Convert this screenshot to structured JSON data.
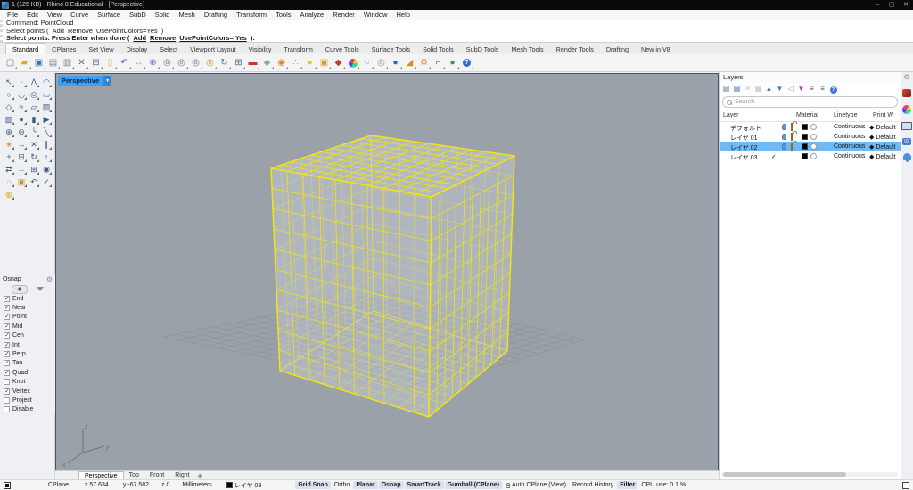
{
  "window": {
    "title": "1 (125 KB) - Rhino 8 Educational - [Perspective]",
    "controls": [
      {
        "name": "minimize",
        "glyph": "–"
      },
      {
        "name": "maximize",
        "glyph": "▢"
      },
      {
        "name": "close",
        "glyph": "✕"
      }
    ]
  },
  "menu": [
    "File",
    "Edit",
    "View",
    "Curve",
    "Surface",
    "SubD",
    "Solid",
    "Mesh",
    "Drafting",
    "Transform",
    "Tools",
    "Analyze",
    "Render",
    "Window",
    "Help"
  ],
  "command": {
    "lines": [
      {
        "prefix": "Command: PointCloud",
        "options": [],
        "suffix": "",
        "bold": false,
        "underline": false
      },
      {
        "prefix": "Select points ( ",
        "options": [
          "Add",
          "Remove",
          "UsePointColors=Yes"
        ],
        "suffix": " )",
        "bold": false,
        "underline": false
      },
      {
        "prefix": "Select points. Press Enter when done ( ",
        "options": [
          "Add",
          "Remove",
          "UsePointColors= Yes"
        ],
        "suffix": " ):",
        "bold": true,
        "underline": true
      }
    ]
  },
  "toolbar_tabs": {
    "active": "Standard",
    "tabs": [
      "Standard",
      "CPlanes",
      "Set View",
      "Display",
      "Select",
      "Viewport Layout",
      "Visibility",
      "Transform",
      "Curve Tools",
      "Surface Tools",
      "Solid Tools",
      "SubD Tools",
      "Mesh Tools",
      "Render Tools",
      "Drafting",
      "New in V8"
    ]
  },
  "standard_toolbar": [
    {
      "name": "new-file",
      "glyph": "▢",
      "color": "#6b7c92"
    },
    {
      "name": "open-file",
      "glyph": "▰",
      "color": "#e0a33a"
    },
    {
      "name": "save",
      "glyph": "▣",
      "color": "#3f6fb5"
    },
    {
      "name": "print",
      "glyph": "▤",
      "color": "#7c8692"
    },
    {
      "name": "export",
      "glyph": "▥",
      "color": "#7c8692"
    },
    {
      "name": "cut",
      "glyph": "✕",
      "color": "#5a6b7c"
    },
    {
      "name": "copy",
      "glyph": "⊟",
      "color": "#5a6b7c"
    },
    {
      "name": "paste",
      "glyph": "▯",
      "color": "#e0a33a"
    },
    {
      "name": "undo",
      "glyph": "↶",
      "color": "#3f6fb5"
    },
    {
      "name": "pan-view",
      "glyph": "↔",
      "color": "#d9a05a"
    },
    {
      "name": "move",
      "glyph": "⊕",
      "color": "#8a5ad4"
    },
    {
      "name": "zoom-dynamic",
      "glyph": "◎",
      "color": "#5a7c9c"
    },
    {
      "name": "zoom-window",
      "glyph": "◎",
      "color": "#5a7c9c"
    },
    {
      "name": "zoom-extents",
      "glyph": "◎",
      "color": "#5a7c9c"
    },
    {
      "name": "zoom-selected",
      "glyph": "◎",
      "color": "#d98a2b"
    },
    {
      "name": "rotate-view",
      "glyph": "↻",
      "color": "#3f6fb5"
    },
    {
      "name": "viewport-layout",
      "glyph": "⊞",
      "color": "#5a6b7c"
    },
    {
      "name": "display-mode-rendered",
      "glyph": "▬",
      "color": "#c23b2e"
    },
    {
      "name": "display-mode-shaded",
      "glyph": "◆",
      "color": "#98a2ae"
    },
    {
      "name": "sun-study",
      "glyph": "◉",
      "color": "#d98a2b"
    },
    {
      "name": "object-snap-points",
      "glyph": "∴",
      "color": "#d98a2b"
    },
    {
      "name": "hide-objects",
      "glyph": "●",
      "color": "#e8c52a"
    },
    {
      "name": "lock-objects",
      "glyph": "▣",
      "color": "#c9a227"
    },
    {
      "name": "edit-layers",
      "glyph": "◆",
      "color": "#c23b2e"
    },
    {
      "name": "display-properties",
      "glyph": "wheel",
      "color": ""
    },
    {
      "name": "object-properties",
      "glyph": "○",
      "color": "#8a929c"
    },
    {
      "name": "what-is",
      "glyph": "◎",
      "color": "#8a929c"
    },
    {
      "name": "render",
      "glyph": "●",
      "color": "#2b5fd4"
    },
    {
      "name": "render-settings",
      "glyph": "◢",
      "color": "#d98a2b"
    },
    {
      "name": "options",
      "glyph": "⚙",
      "color": "#d98a2b"
    },
    {
      "name": "dimension",
      "glyph": "⌐",
      "color": "#5a6b7c"
    },
    {
      "name": "render-earth",
      "glyph": "●",
      "color": "#2ba03a"
    },
    {
      "name": "help",
      "glyph": "?",
      "color": "#ffffff"
    }
  ],
  "left_toolbar": [
    {
      "name": "select",
      "glyph": "↖",
      "color": "#3a5a85"
    },
    {
      "name": "point",
      "glyph": "∙",
      "color": "#3a5a85"
    },
    {
      "name": "polyline",
      "glyph": "Λ",
      "color": "#3a5a85"
    },
    {
      "name": "curve",
      "glyph": "◠",
      "color": "#3a5a85"
    },
    {
      "name": "circle",
      "glyph": "○",
      "color": "#3a5a85"
    },
    {
      "name": "arc",
      "glyph": "◡",
      "color": "#3a5a85"
    },
    {
      "name": "ellipse",
      "glyph": "◎",
      "color": "#3a5a85"
    },
    {
      "name": "rectangle",
      "glyph": "▭",
      "color": "#3a5a85"
    },
    {
      "name": "polygon",
      "glyph": "◇",
      "color": "#3a5a85"
    },
    {
      "name": "sketch",
      "glyph": "≈",
      "color": "#3a5a85"
    },
    {
      "name": "surface",
      "glyph": "▱",
      "color": "#3a5a85"
    },
    {
      "name": "patch",
      "glyph": "▨",
      "color": "#3a5a85"
    },
    {
      "name": "box",
      "glyph": "▧",
      "color": "#3a5a85"
    },
    {
      "name": "sphere",
      "glyph": "●",
      "color": "#3a5a85"
    },
    {
      "name": "extrude",
      "glyph": "▮",
      "color": "#3a5a85"
    },
    {
      "name": "revolve",
      "glyph": "▶",
      "color": "#3a5a85"
    },
    {
      "name": "boolean-union",
      "glyph": "⊕",
      "color": "#3a5a85"
    },
    {
      "name": "boolean-difference",
      "glyph": "⊖",
      "color": "#3a5a85"
    },
    {
      "name": "fillet",
      "glyph": "╰",
      "color": "#3a5a85"
    },
    {
      "name": "chamfer",
      "glyph": "╲",
      "color": "#3a5a85"
    },
    {
      "name": "explode",
      "glyph": "∗",
      "color": "#d98a2b"
    },
    {
      "name": "extend",
      "glyph": "→",
      "color": "#3a5a85"
    },
    {
      "name": "trim",
      "glyph": "✕",
      "color": "#3a5a85"
    },
    {
      "name": "split",
      "glyph": "∥",
      "color": "#3a5a85"
    },
    {
      "name": "move",
      "glyph": "+",
      "color": "#3a5a85"
    },
    {
      "name": "copy-object",
      "glyph": "⊟",
      "color": "#3a5a85"
    },
    {
      "name": "rotate",
      "glyph": "↻",
      "color": "#3a5a85"
    },
    {
      "name": "scale",
      "glyph": "↕",
      "color": "#3a5a85"
    },
    {
      "name": "mirror",
      "glyph": "⇄",
      "color": "#3a5a85"
    },
    {
      "name": "array",
      "glyph": "∴",
      "color": "#3a5a85"
    },
    {
      "name": "join",
      "glyph": "⊞",
      "color": "#3a5a85"
    },
    {
      "name": "group",
      "glyph": "◉",
      "color": "#3a5a85"
    },
    {
      "name": "hide",
      "glyph": "◌",
      "color": "#3a5a85"
    },
    {
      "name": "lock",
      "glyph": "▣",
      "color": "#b8962a"
    },
    {
      "name": "undo-tool",
      "glyph": "↶",
      "color": "#3a5a85"
    },
    {
      "name": "record-history",
      "glyph": "✓",
      "color": "#3a5a85"
    },
    {
      "name": "lamp",
      "glyph": "◍",
      "color": "#d0a818"
    }
  ],
  "osnap": {
    "title": "Osnap",
    "items": [
      {
        "label": "End",
        "checked": true
      },
      {
        "label": "Near",
        "checked": true
      },
      {
        "label": "Point",
        "checked": true
      },
      {
        "label": "Mid",
        "checked": true
      },
      {
        "label": "Cen",
        "checked": true
      },
      {
        "label": "Int",
        "checked": true
      },
      {
        "label": "Perp",
        "checked": true
      },
      {
        "label": "Tan",
        "checked": true
      },
      {
        "label": "Quad",
        "checked": true
      },
      {
        "label": "Knot",
        "checked": false
      },
      {
        "label": "Vertex",
        "checked": true
      },
      {
        "label": "Project",
        "checked": false
      },
      {
        "label": "Disable",
        "checked": false
      }
    ]
  },
  "viewport": {
    "label": "Perspective",
    "axis_labels": {
      "x": "x",
      "y": "y",
      "z": "z"
    }
  },
  "viewport_tabs": {
    "active": "Perspective",
    "tabs": [
      "Perspective",
      "Top",
      "Front",
      "Right"
    ],
    "new_tab_glyph": "◈"
  },
  "layers": {
    "title": "Layers",
    "search_placeholder": "Search",
    "toolbar": [
      {
        "name": "new-layer",
        "glyph": "▤",
        "color": "#6b7c92"
      },
      {
        "name": "new-sublayer",
        "glyph": "▤",
        "color": "#3f6fb5"
      },
      {
        "name": "delete-layer",
        "glyph": "✕",
        "color": "#bdc2c8"
      },
      {
        "name": "duplicate-layer",
        "glyph": "▦",
        "color": "#bdc2c8"
      },
      {
        "name": "move-up",
        "glyph": "▲",
        "color": "#3f78d6"
      },
      {
        "name": "move-down",
        "glyph": "▼",
        "color": "#3f78d6"
      },
      {
        "name": "collapse",
        "glyph": "◁",
        "color": "#9aa0a6"
      },
      {
        "name": "filter",
        "glyph": "▼",
        "color": "#b13fc9"
      },
      {
        "name": "list-view",
        "glyph": "≡",
        "color": "#555555"
      },
      {
        "name": "panel-menu",
        "glyph": "≡",
        "color": "#555555"
      },
      {
        "name": "help",
        "glyph": "?",
        "color": "#ffffff"
      }
    ],
    "columns": [
      "Layer",
      "Material",
      "Linetype",
      "Print W"
    ],
    "rows": [
      {
        "name": "デフォルト",
        "current": false,
        "visible": true,
        "locked": false,
        "color": "#000000",
        "linetype": "Continuous",
        "print_width": "Default",
        "selected": false,
        "state_icons": true
      },
      {
        "name": "レイヤ 01",
        "current": false,
        "visible": true,
        "locked": false,
        "color": "#000000",
        "linetype": "Continuous",
        "print_width": "Default",
        "selected": false,
        "state_icons": true
      },
      {
        "name": "レイヤ 02",
        "current": false,
        "visible": true,
        "locked": false,
        "color": "#000000",
        "linetype": "Continuous",
        "print_width": "Default",
        "selected": true,
        "state_icons": true
      },
      {
        "name": "レイヤ 03",
        "current": true,
        "visible": true,
        "locked": false,
        "color": "#000000",
        "linetype": "Continuous",
        "print_width": "Default",
        "selected": false,
        "state_icons": false
      }
    ]
  },
  "right_strip": [
    {
      "name": "panel-gear",
      "type": "gear"
    },
    {
      "name": "tab-materials",
      "type": "materials"
    },
    {
      "name": "tab-display",
      "type": "wheel"
    },
    {
      "name": "tab-rendering",
      "type": "monitor"
    },
    {
      "name": "tab-layer-states",
      "type": "layerstate",
      "label": "02"
    },
    {
      "name": "tab-notifications",
      "type": "bell"
    }
  ],
  "status_bar": {
    "fields": [
      {
        "name": "cplane",
        "text": "CPlane",
        "ml": 42
      },
      {
        "name": "coord-x",
        "text": "x 57.634",
        "ml": 18
      },
      {
        "name": "coord-y",
        "text": "y -67.582",
        "ml": 16
      },
      {
        "name": "coord-z",
        "text": "z 0",
        "ml": 14
      },
      {
        "name": "units",
        "text": "Millimeters",
        "ml": 14
      }
    ],
    "layer_chip": {
      "color": "#000000",
      "label": "レイヤ 03"
    },
    "toggles": [
      {
        "label": "Grid Snap",
        "active": true,
        "lock": false
      },
      {
        "label": "Ortho",
        "active": false,
        "lock": false
      },
      {
        "label": "Planar",
        "active": true,
        "lock": false
      },
      {
        "label": "Osnap",
        "active": true,
        "lock": false
      },
      {
        "label": "SmartTrack",
        "active": true,
        "lock": false
      },
      {
        "label": "Gumball (CPlane)",
        "active": true,
        "lock": false
      },
      {
        "label": "Auto CPlane (View)",
        "active": false,
        "lock": true
      },
      {
        "label": "Record History",
        "active": false,
        "lock": false
      },
      {
        "label": "Filter",
        "active": true,
        "lock": false
      },
      {
        "label": "CPU use: 0.1 %",
        "active": false,
        "lock": false
      }
    ]
  }
}
